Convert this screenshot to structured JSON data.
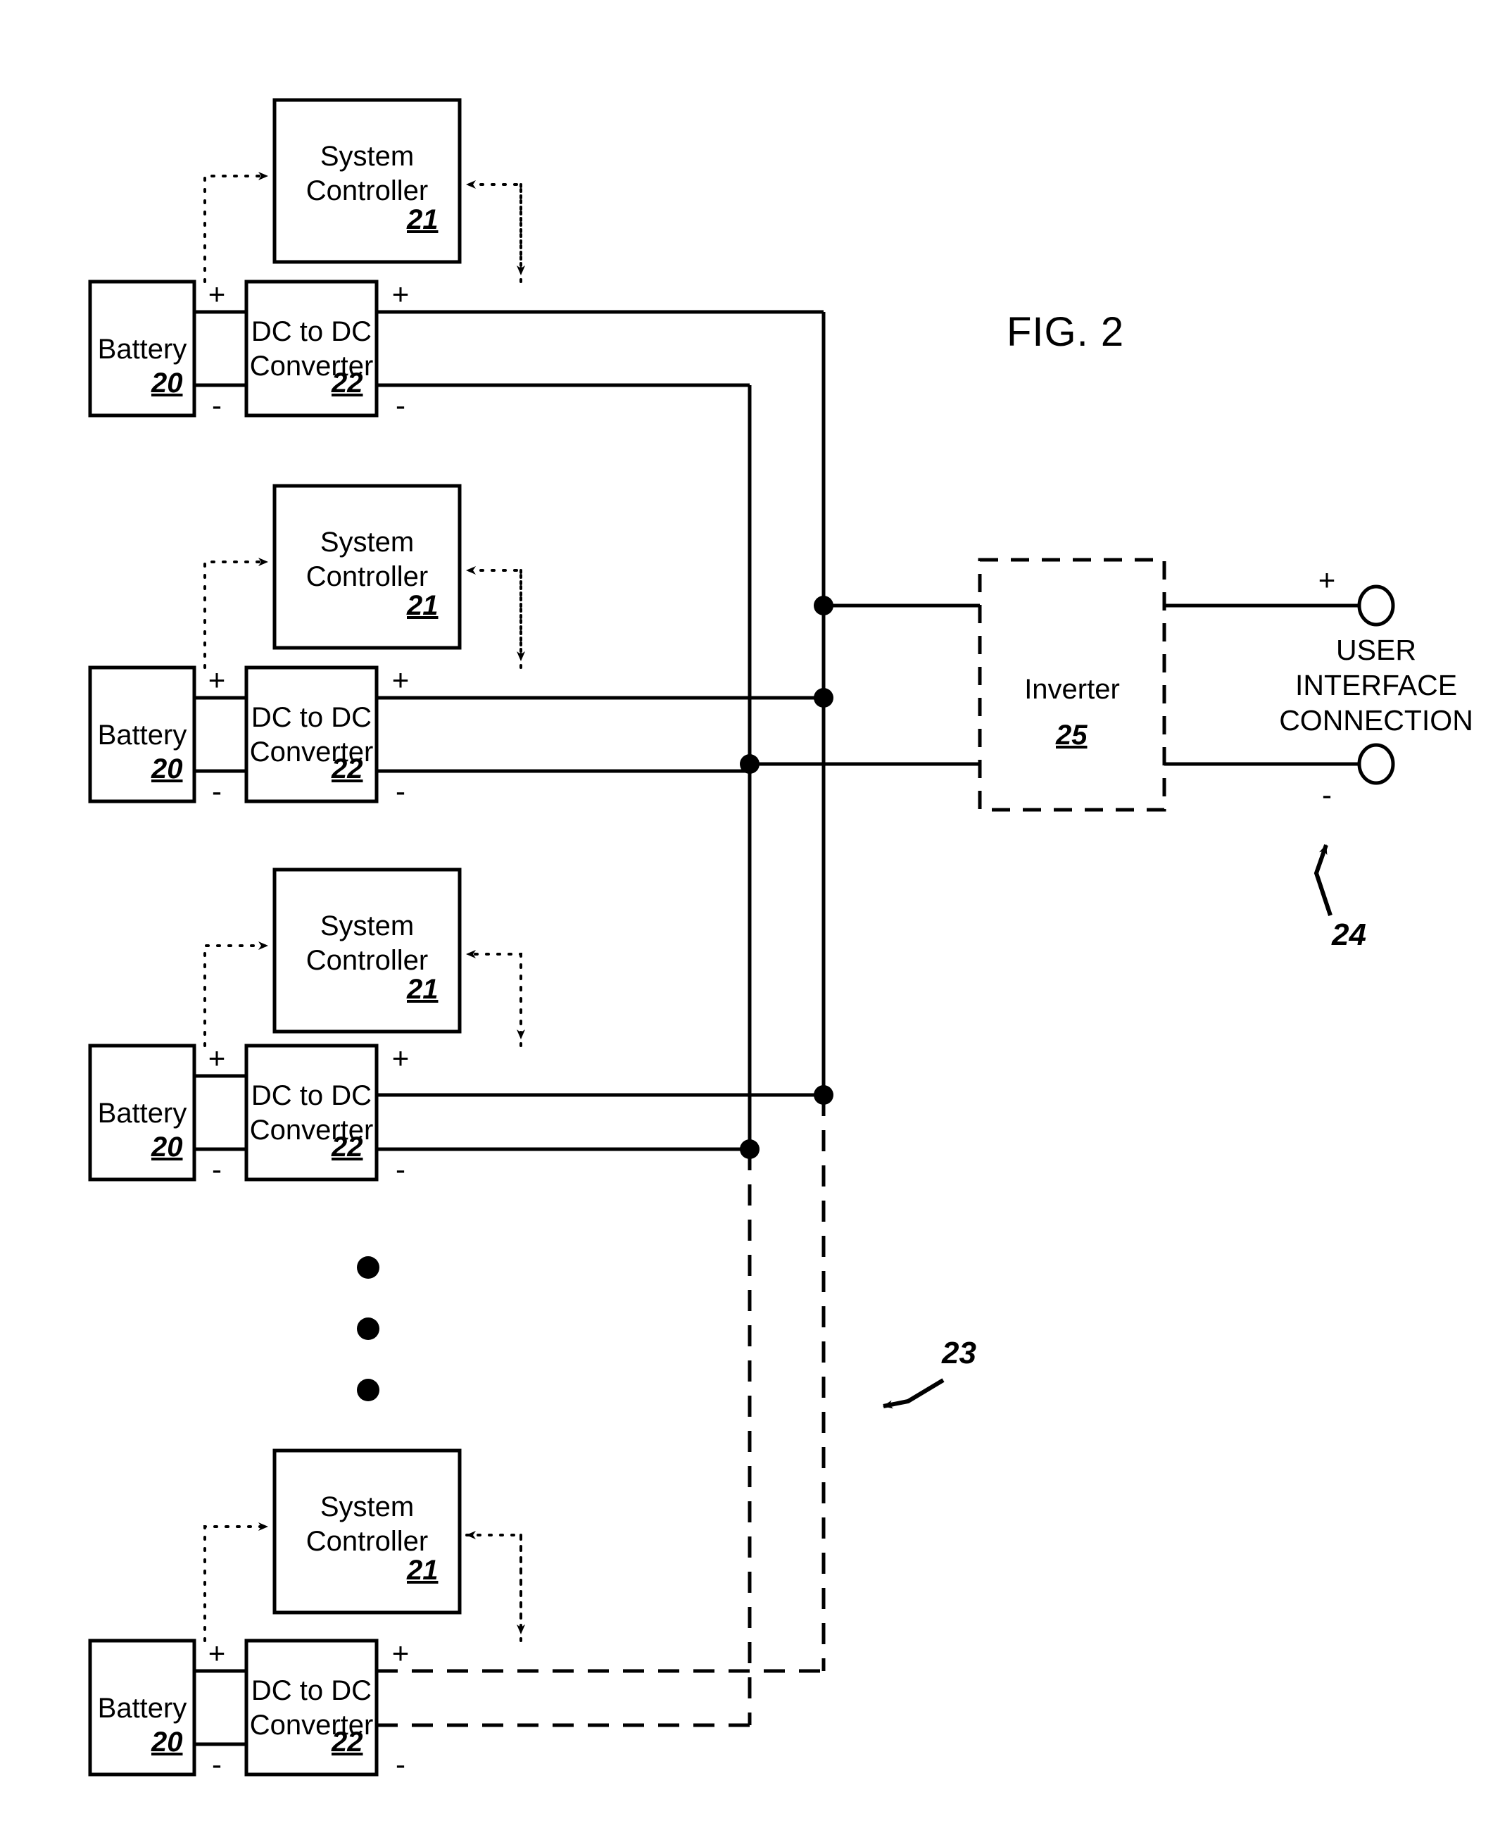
{
  "figure": {
    "title": "FIG. 2"
  },
  "blocks": {
    "system_controller": {
      "label": "System\nController",
      "number": "21"
    },
    "battery": {
      "label": "Battery",
      "number": "20"
    },
    "dcdc": {
      "label": "DC to DC\nConverter",
      "number": "22"
    },
    "inverter": {
      "label": "Inverter",
      "number": "25"
    }
  },
  "polarity": {
    "plus": "+",
    "minus": "-"
  },
  "user_interface": {
    "label": "USER\nINTERFACE\nCONNECTION"
  },
  "references": {
    "bus": "23",
    "output": "24"
  },
  "rows": [
    {
      "index": 1,
      "controller": {
        "label": "System\nController",
        "number": "21"
      },
      "battery": {
        "label": "Battery",
        "number": "20"
      },
      "converter": {
        "label": "DC to DC\nConverter",
        "number": "22"
      },
      "battery_plus": "+",
      "battery_minus": "-",
      "out_plus": "+",
      "out_minus": "-"
    },
    {
      "index": 2,
      "controller": {
        "label": "System\nController",
        "number": "21"
      },
      "battery": {
        "label": "Battery",
        "number": "20"
      },
      "converter": {
        "label": "DC to DC\nConverter",
        "number": "22"
      },
      "battery_plus": "+",
      "battery_minus": "-",
      "out_plus": "+",
      "out_minus": "-"
    },
    {
      "index": 3,
      "controller": {
        "label": "System\nController",
        "number": "21"
      },
      "battery": {
        "label": "Battery",
        "number": "20"
      },
      "converter": {
        "label": "DC to DC\nConverter",
        "number": "22"
      },
      "battery_plus": "+",
      "battery_minus": "-",
      "out_plus": "+",
      "out_minus": "-"
    },
    {
      "index": 4,
      "controller": {
        "label": "System\nController",
        "number": "21"
      },
      "battery": {
        "label": "Battery",
        "number": "20"
      },
      "converter": {
        "label": "DC to DC\nConverter",
        "number": "22"
      },
      "battery_plus": "+",
      "battery_minus": "-",
      "out_plus": "+",
      "out_minus": "-"
    }
  ],
  "ellipsis": {
    "dots": 3
  },
  "colors": {
    "stroke": "#000000",
    "background": "#ffffff"
  }
}
